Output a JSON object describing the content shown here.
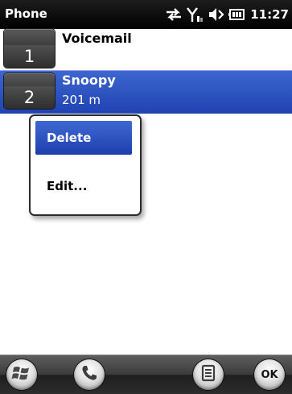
{
  "status_bar": {
    "title": "Phone",
    "time": "11:27",
    "icons": [
      "data-arrows-icon",
      "signal-icon",
      "volume-icon",
      "battery-icon"
    ]
  },
  "speed_dial": {
    "entries": [
      {
        "key": "1",
        "name": "Voicemail",
        "detail": ""
      },
      {
        "key": "2",
        "name": "Snoopy",
        "detail": "201 m"
      }
    ],
    "selected_index": 1
  },
  "context_menu": {
    "items": [
      {
        "label": "Delete",
        "selected": true
      },
      {
        "label": "Edit...",
        "selected": false
      }
    ]
  },
  "softkeys": {
    "icons": [
      "windows-start-icon",
      "phone-icon",
      "menu-icon",
      "ok-icon"
    ],
    "ok_label": "OK"
  },
  "colors": {
    "highlight": "#2d52c2",
    "status_bar": "#000000",
    "softkey_bar": "#3b3b3b"
  }
}
